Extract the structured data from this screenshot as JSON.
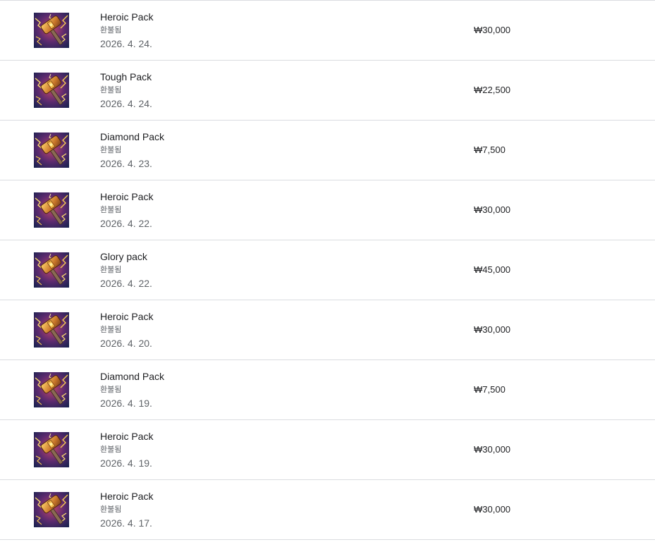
{
  "purchases": [
    {
      "name": "Heroic Pack",
      "status": "환불됨",
      "date": "2026. 4. 24.",
      "price": "₩30,000",
      "icon": "hammer-pack-icon"
    },
    {
      "name": "Tough Pack",
      "status": "환불됨",
      "date": "2026. 4. 24.",
      "price": "₩22,500",
      "icon": "hammer-pack-icon"
    },
    {
      "name": "Diamond Pack",
      "status": "환불됨",
      "date": "2026. 4. 23.",
      "price": "₩7,500",
      "icon": "hammer-pack-icon"
    },
    {
      "name": "Heroic Pack",
      "status": "환불됨",
      "date": "2026. 4. 22.",
      "price": "₩30,000",
      "icon": "hammer-pack-icon"
    },
    {
      "name": "Glory pack",
      "status": "환불됨",
      "date": "2026. 4. 22.",
      "price": "₩45,000",
      "icon": "hammer-pack-icon"
    },
    {
      "name": "Heroic Pack",
      "status": "환불됨",
      "date": "2026. 4. 20.",
      "price": "₩30,000",
      "icon": "hammer-pack-icon"
    },
    {
      "name": "Diamond Pack",
      "status": "환불됨",
      "date": "2026. 4. 19.",
      "price": "₩7,500",
      "icon": "hammer-pack-icon"
    },
    {
      "name": "Heroic Pack",
      "status": "환불됨",
      "date": "2026. 4. 19.",
      "price": "₩30,000",
      "icon": "hammer-pack-icon"
    },
    {
      "name": "Heroic Pack",
      "status": "환불됨",
      "date": "2026. 4. 17.",
      "price": "₩30,000",
      "icon": "hammer-pack-icon"
    }
  ],
  "colors": {
    "divider": "#dadce0",
    "primary_text": "#202124",
    "secondary_text": "#5f6368"
  }
}
